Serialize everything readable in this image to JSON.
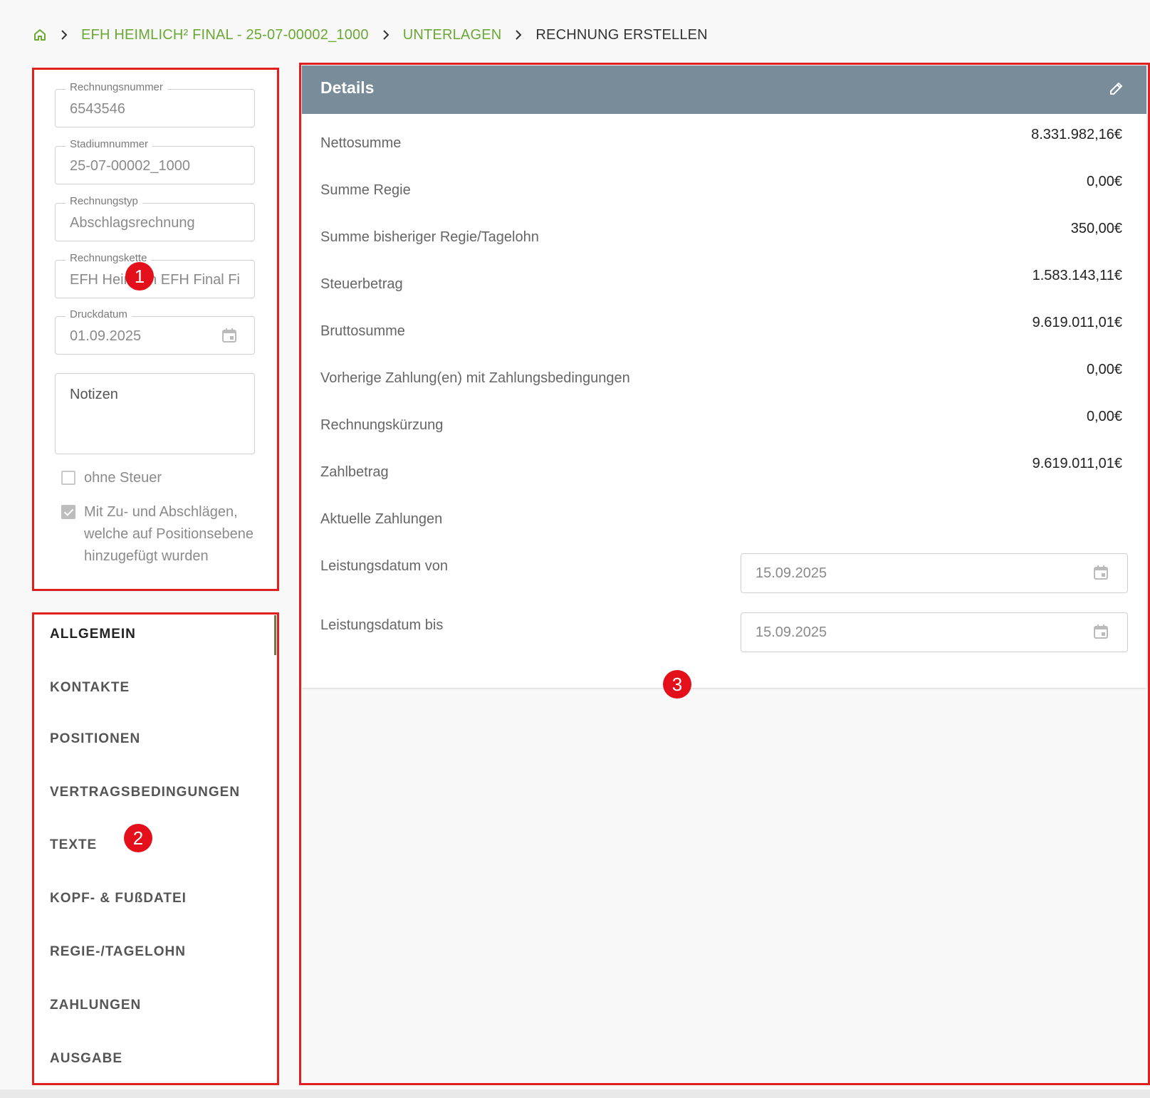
{
  "breadcrumb": {
    "project": "EFH HEIMLICH² FINAL - 25-07-00002_1000",
    "section": "UNTERLAGEN",
    "current": "RECHNUNG ERSTELLEN"
  },
  "form": {
    "rechnungsnummer": {
      "label": "Rechnungsnummer",
      "value": "6543546"
    },
    "stadiumnummer": {
      "label": "Stadiumnummer",
      "value": "25-07-00002_1000"
    },
    "rechnungstyp": {
      "label": "Rechnungstyp",
      "value": "Abschlagsrechnung"
    },
    "rechnungskette": {
      "label": "Rechnungskette",
      "value": "EFH Heimlich EFH Final Fi"
    },
    "druckdatum": {
      "label": "Druckdatum",
      "value": "01.09.2025"
    },
    "notizen": {
      "placeholder": "Notizen"
    },
    "ohne_steuer": {
      "label": "ohne Steuer",
      "checked": false
    },
    "zu_abschlaege": {
      "label_line1": "Mit Zu- und Abschlägen,",
      "label_line2": "welche auf Positionsebene",
      "label_line3": "hinzugefügt wurden",
      "checked": true
    }
  },
  "nav": {
    "items": [
      {
        "label": "ALLGEMEIN",
        "active": true
      },
      {
        "label": "KONTAKTE"
      },
      {
        "label": "POSITIONEN"
      },
      {
        "label": "VERTRAGSBEDINGUNGEN"
      },
      {
        "label": "TEXTE"
      },
      {
        "label": "KOPF- & FUßDATEI"
      },
      {
        "label": "REGIE-/TAGELOHN"
      },
      {
        "label": "ZAHLUNGEN"
      },
      {
        "label": "AUSGABE"
      }
    ]
  },
  "details": {
    "title": "Details",
    "rows": [
      {
        "label": "Nettosumme",
        "value": "8.331.982,16€"
      },
      {
        "label": "Summe Regie",
        "value": "0,00€"
      },
      {
        "label": "Summe bisheriger Regie/Tagelohn",
        "value": "350,00€"
      },
      {
        "label": "Steuerbetrag",
        "value": "1.583.143,11€"
      },
      {
        "label": "Bruttosumme",
        "value": "9.619.011,01€"
      },
      {
        "label": "Vorherige Zahlung(en) mit Zahlungsbedingungen",
        "value": "0,00€"
      },
      {
        "label": "Rechnungskürzung",
        "value": "0,00€"
      },
      {
        "label": "Zahlbetrag",
        "value": "9.619.011,01€"
      },
      {
        "label": "Aktuelle Zahlungen",
        "value": ""
      }
    ],
    "leistungsdatum_von": {
      "label": "Leistungsdatum von",
      "value": "15.09.2025"
    },
    "leistungsdatum_bis": {
      "label": "Leistungsdatum bis",
      "value": "15.09.2025"
    }
  },
  "annotations": {
    "badge1": "1",
    "badge2": "2",
    "badge3": "3"
  },
  "colors": {
    "accent": "#6aa834",
    "header": "#788c99",
    "annotation": "#e3101b"
  },
  "icons": [
    "home-icon",
    "chevron-right-icon",
    "calendar-icon",
    "pencil-icon",
    "checkbox-icon"
  ]
}
